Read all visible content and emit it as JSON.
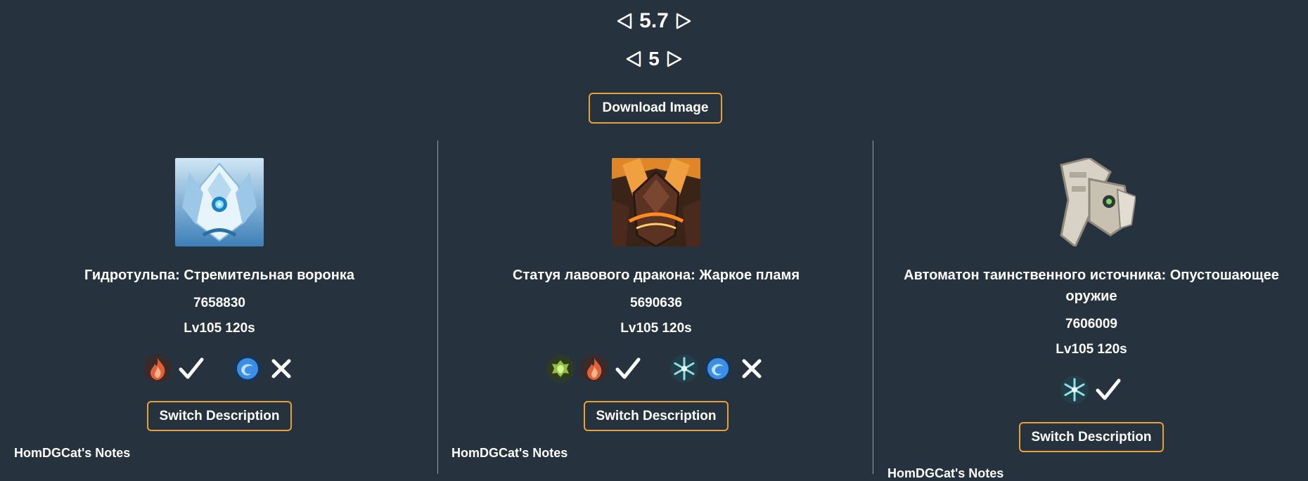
{
  "nav": {
    "version": "5.7",
    "floor": "5"
  },
  "download_label": "Download Image",
  "switch_label": "Switch Description",
  "notes_label": "HomDGCat's Notes",
  "enemies": [
    {
      "name": "Гидротульпа: Стремительная воронка",
      "hp": "7658830",
      "level": "Lv105 120s",
      "groups": [
        {
          "elements": [
            "pyro-icon"
          ],
          "result": "check"
        },
        {
          "elements": [
            "hydro-icon"
          ],
          "result": "cross"
        }
      ]
    },
    {
      "name": "Статуя лавового дракона: Жаркое пламя",
      "hp": "5690636",
      "level": "Lv105 120s",
      "groups": [
        {
          "elements": [
            "dendro-icon",
            "pyro-icon"
          ],
          "result": "check"
        },
        {
          "elements": [
            "cryo-icon",
            "hydro-icon"
          ],
          "result": "cross"
        }
      ]
    },
    {
      "name": "Автоматон таинственного источника: Опустошающее оружие",
      "hp": "7606009",
      "level": "Lv105 120s",
      "groups": [
        {
          "elements": [
            "cryo-icon"
          ],
          "result": "check"
        }
      ]
    }
  ],
  "colors": {
    "background": "#26323d",
    "accent_border": "#e8a13a",
    "divider": "#9aa3ab",
    "pyro": "#e2603a",
    "hydro": "#3a8ee8",
    "dendro": "#8fc23a",
    "cryo": "#8fe0e8"
  }
}
